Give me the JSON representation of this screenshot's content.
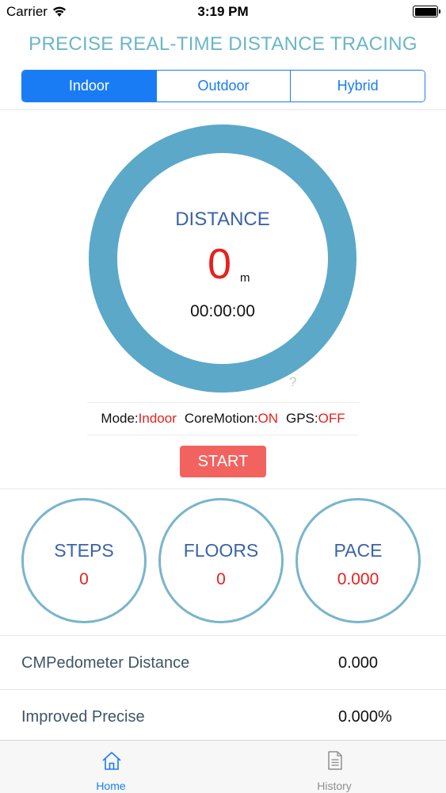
{
  "status_bar": {
    "carrier": "Carrier",
    "time": "3:19 PM"
  },
  "header": {
    "title": "PRECISE REAL-TIME DISTANCE TRACING"
  },
  "mode_selector": {
    "segments": [
      {
        "label": "Indoor",
        "selected": true
      },
      {
        "label": "Outdoor",
        "selected": false
      },
      {
        "label": "Hybrid",
        "selected": false
      }
    ]
  },
  "distance": {
    "label": "DISTANCE",
    "value": "0",
    "unit": "m",
    "elapsed": "00:00:00",
    "help_glyph": "?"
  },
  "status_line": {
    "mode_key": "Mode:",
    "mode_value": "Indoor",
    "coremotion_key": "CoreMotion:",
    "coremotion_value": "ON",
    "gps_key": "GPS:",
    "gps_value": "OFF"
  },
  "start_button": {
    "label": "START"
  },
  "stats": [
    {
      "label": "STEPS",
      "value": "0"
    },
    {
      "label": "FLOORS",
      "value": "0"
    },
    {
      "label": "PACE",
      "value": "0.000"
    }
  ],
  "metrics": [
    {
      "label": "CMPedometer Distance",
      "value": "0.000"
    },
    {
      "label": "Improved Precise",
      "value": "0.000%"
    }
  ],
  "tab_bar": {
    "tabs": [
      {
        "label": "Home",
        "icon": "home-icon",
        "active": true
      },
      {
        "label": "History",
        "icon": "history-icon",
        "active": false
      }
    ]
  },
  "colors": {
    "accent": "#1a7cf5",
    "ring": "#5ba8c9",
    "title": "#6ab6c9",
    "value_red": "#e8201c",
    "start_button": "#f26360",
    "label_blue": "#3b63a8"
  }
}
